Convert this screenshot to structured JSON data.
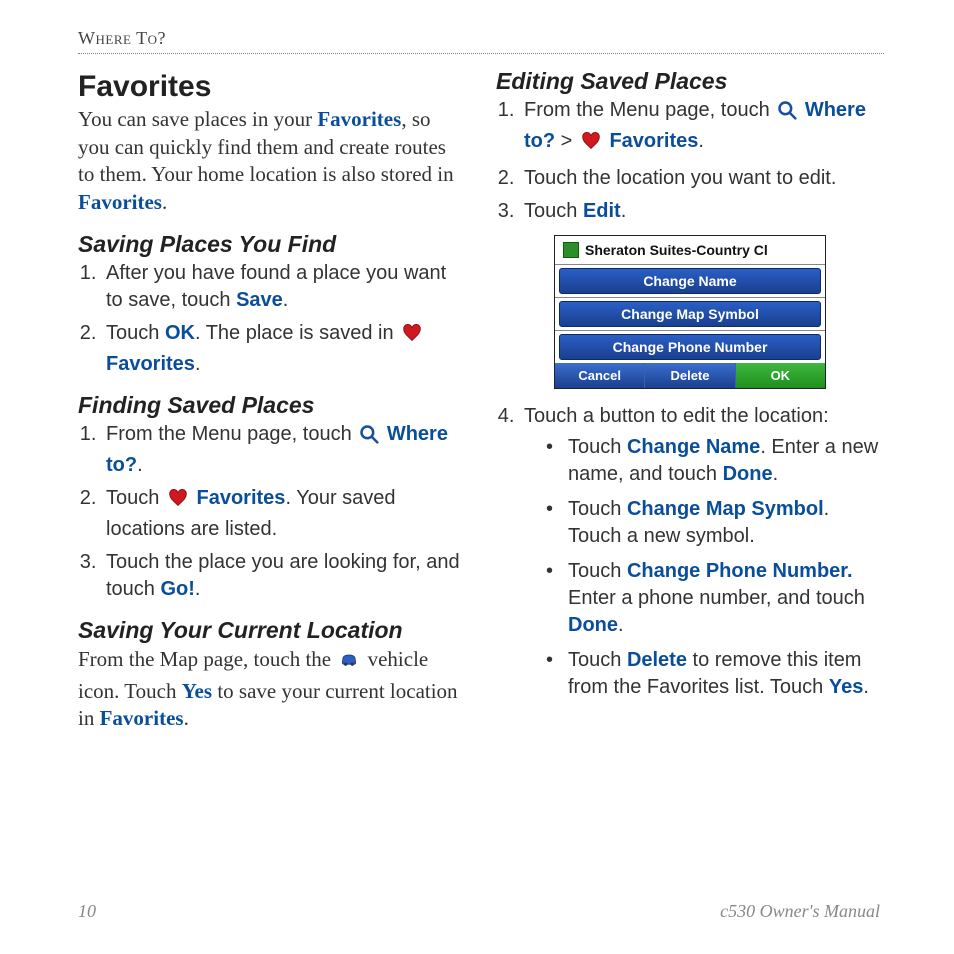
{
  "breadcrumb": "Where To?",
  "title": "Favorites",
  "intro_parts": {
    "a": "You can save places in your ",
    "b": "Favorites",
    "c": ", so you can quickly find them and create routes to them. Your home location is also stored in ",
    "d": "Favorites",
    "e": "."
  },
  "saving_find": {
    "heading": "Saving Places You Find",
    "step1_a": "After you have found a place you want to save, touch ",
    "step1_kw": "Save",
    "step1_b": ".",
    "step2_a": "Touch ",
    "step2_kw1": "OK",
    "step2_b": ". The place is saved in ",
    "step2_kw2": "Favorites",
    "step2_c": "."
  },
  "finding": {
    "heading": "Finding Saved Places",
    "step1_a": "From the Menu page, touch ",
    "step1_kw": "Where to?",
    "step1_b": ".",
    "step2_a": "Touch ",
    "step2_kw": "Favorites",
    "step2_b": ". Your saved locations are listed.",
    "step3_a": "Touch the place you are looking for, and touch ",
    "step3_kw": "Go!",
    "step3_b": "."
  },
  "saving_current": {
    "heading": "Saving Your Current Location",
    "a": "From the Map page, touch the ",
    "b": " vehicle icon. Touch ",
    "kw1": "Yes",
    "c": " to save your current location in ",
    "kw2": "Favorites",
    "d": "."
  },
  "editing": {
    "heading": "Editing Saved Places",
    "step1_a": "From the Menu page, touch ",
    "step1_kw1": "Where to?",
    "step1_mid": " > ",
    "step1_kw2": "Favorites",
    "step1_b": ".",
    "step2": "Touch the location you want to edit.",
    "step3_a": "Touch ",
    "step3_kw": "Edit",
    "step3_b": ".",
    "step4_a": "Touch a button to edit the location:",
    "b1_a": "Touch ",
    "b1_kw": "Change Name",
    "b1_b": ". Enter a new name, and touch ",
    "b1_kw2": "Done",
    "b1_c": ".",
    "b2_a": "Touch ",
    "b2_kw": "Change Map Symbol",
    "b2_b": ". Touch a new symbol.",
    "b3_a": "Touch ",
    "b3_kw": "Change Phone Number.",
    "b3_b": " Enter a phone number, and touch ",
    "b3_kw2": "Done",
    "b3_c": ".",
    "b4_a": "Touch ",
    "b4_kw": "Delete",
    "b4_b": " to remove this item from the Favorites list. Touch ",
    "b4_kw2": "Yes",
    "b4_c": "."
  },
  "device": {
    "title": "Sheraton Suites-Country Cl",
    "btn1": "Change Name",
    "btn2": "Change Map Symbol",
    "btn3": "Change Phone Number",
    "cancel": "Cancel",
    "delete": "Delete",
    "ok": "OK"
  },
  "footer_page": "10",
  "footer_label": "c530 Owner's Manual"
}
